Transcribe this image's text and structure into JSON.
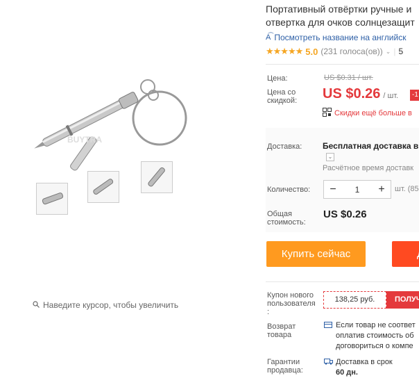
{
  "gallery": {
    "zoom_hint": "Наведите курсор, чтобы увеличить",
    "watermark": "BUYTRA"
  },
  "product": {
    "title_line1": "Портативный отвёртки ручные и",
    "title_line2": "отвертка для очков солнцезащит",
    "translate_link": "Посмотреть название на английск",
    "rating_value": "5.0",
    "votes": "(231 голоса(ов))",
    "rating_extra": "5",
    "stars": "★★★★★"
  },
  "price": {
    "label_price": "Цена:",
    "old_price": "US $0.31 / шт.",
    "label_discount_line1": "Цена со",
    "label_discount_line2": "скидкой:",
    "current_price": "US $0.26",
    "unit": "/ шт.",
    "discount_badge": "-1",
    "promo_text": "Скидки ещё больше в"
  },
  "shipping": {
    "label": "Доставка:",
    "main": "Бесплатная доставка в",
    "estimate": "Расчётное время доставк"
  },
  "quantity": {
    "label": "Количество:",
    "minus": "−",
    "value": "1",
    "plus": "+",
    "unit_text": "шт. (85"
  },
  "total": {
    "label_line1": "Общая",
    "label_line2": "стоимость:",
    "value": "US $0.26"
  },
  "actions": {
    "buy_now": "Купить сейчас",
    "add_to_cart": "Д"
  },
  "coupon": {
    "label_line1": "Купон нового",
    "label_line2": "пользователя",
    "label_line3": ":",
    "amount": "138,25 руб.",
    "button": "ПОЛУЧ"
  },
  "returns": {
    "label_line1": "Возврат",
    "label_line2": "товара",
    "text_line1": "Если товар не соответ",
    "text_line2": "оплатив стоимость об",
    "text_line3": "договориться о компе"
  },
  "guarantee": {
    "label_line1": "Гарантии",
    "label_line2": "продавца:",
    "text_line1": "Доставка в срок",
    "text_line2": "60 дн."
  },
  "colors": {
    "accent_red": "#e4393c",
    "buy_orange": "#ff9a1f",
    "cart_orange": "#ff4a21",
    "star": "#f5a623",
    "link": "#2d5fa6"
  }
}
